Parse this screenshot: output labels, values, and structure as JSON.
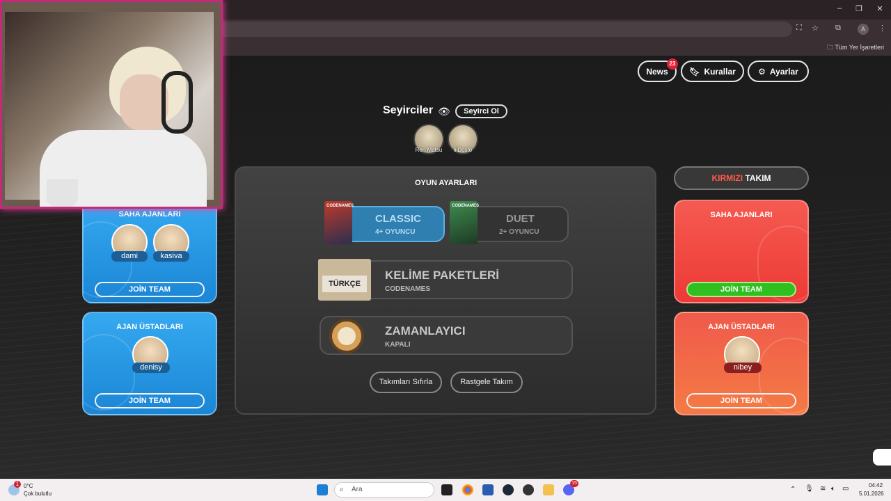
{
  "browser": {
    "bookmarks_all": "Tüm Yer İşaretleri",
    "profile_letter": "A",
    "window_controls": [
      "–",
      "❐",
      "✕"
    ]
  },
  "header": {
    "news_label": "News",
    "news_count": "23",
    "rules_label": "Kurallar",
    "settings_label": "Ayarlar"
  },
  "spectators": {
    "title": "Seyirciler",
    "join_label": "Seyirci Ol",
    "users": [
      "Ren Matsu",
      "lilDosto"
    ]
  },
  "game_settings": {
    "title": "OYUN AYARLARI",
    "modes": [
      {
        "name": "CLASSIC",
        "players": "4+ OYUNCU",
        "box_title": "CODENAMES",
        "selected": true
      },
      {
        "name": "DUET",
        "players": "2+ OYUNCU",
        "box_title": "CODENAMES",
        "selected": false
      }
    ],
    "word_packs": {
      "title": "KELİME PAKETLERİ",
      "sub": "CODENAMES",
      "flag_label": "TÜRKÇE"
    },
    "timer": {
      "title": "ZAMANLAYICI",
      "sub": "KAPALI"
    },
    "reset_teams": "Takımları Sıfırla",
    "random_team": "Rastgele Takım"
  },
  "blue_team": {
    "field_agents": {
      "title": "SAHA AJANLARI",
      "members": [
        "dami",
        "kasiva"
      ],
      "join": "JOİN TEAM"
    },
    "spymasters": {
      "title": "AJAN ÜSTADLARI",
      "members": [
        "denisy"
      ],
      "join": "JOİN TEAM"
    }
  },
  "red_team": {
    "header_color_word": "KIRMIZI",
    "header_rest": "TAKIM",
    "field_agents": {
      "title": "SAHA AJANLARI",
      "members": [],
      "join": "JOİN TEAM"
    },
    "spymasters": {
      "title": "AJAN ÜSTADLARI",
      "members": [
        "nibey"
      ],
      "join": "JOİN TEAM"
    }
  },
  "taskbar": {
    "weather_temp": "0°C",
    "weather_desc": "Çok bulutlu",
    "weather_badge": "1",
    "search_placeholder": "Ara",
    "time": "04:42",
    "date": "5.01.2026",
    "discord_badge": "15"
  },
  "colors": {
    "blue_team": "#2a98e4",
    "red_team": "#f04a44",
    "join_green": "#2fbf1f",
    "accent_red_text": "#ff5a4a",
    "webcam_border": "#c22b7a"
  }
}
